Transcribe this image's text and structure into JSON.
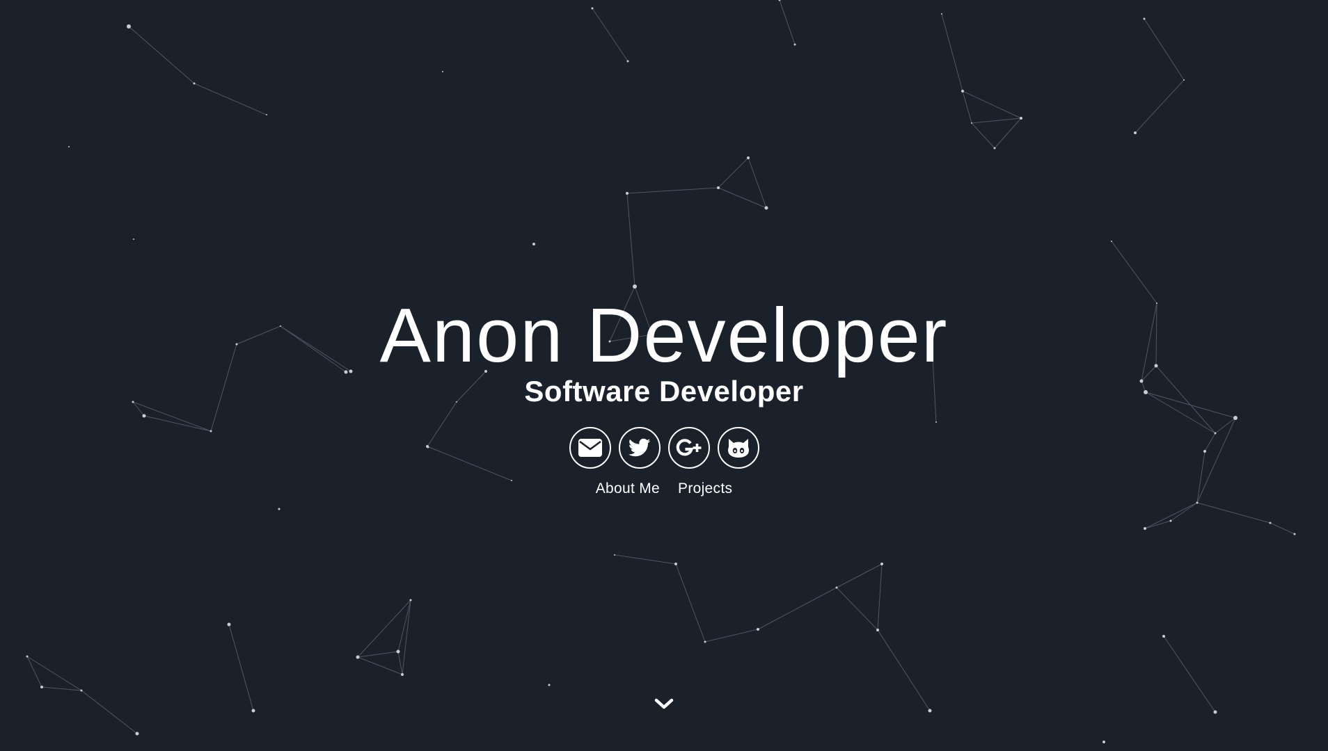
{
  "profile": {
    "name": "Anon Developer",
    "role": "Software Developer"
  },
  "socials": [
    {
      "icon": "envelope-icon",
      "label": "Email"
    },
    {
      "icon": "twitter-icon",
      "label": "Twitter"
    },
    {
      "icon": "google-plus-icon",
      "label": "Google+"
    },
    {
      "icon": "github-icon",
      "label": "GitHub"
    }
  ],
  "nav": {
    "about_label": "About Me",
    "projects_label": "Projects"
  },
  "scroll": {
    "icon": "chevron-down-icon"
  },
  "theme": {
    "background": "#1b212b",
    "foreground": "#ffffff",
    "particle": "#c9ccd2",
    "link_line": "#5a606b"
  }
}
